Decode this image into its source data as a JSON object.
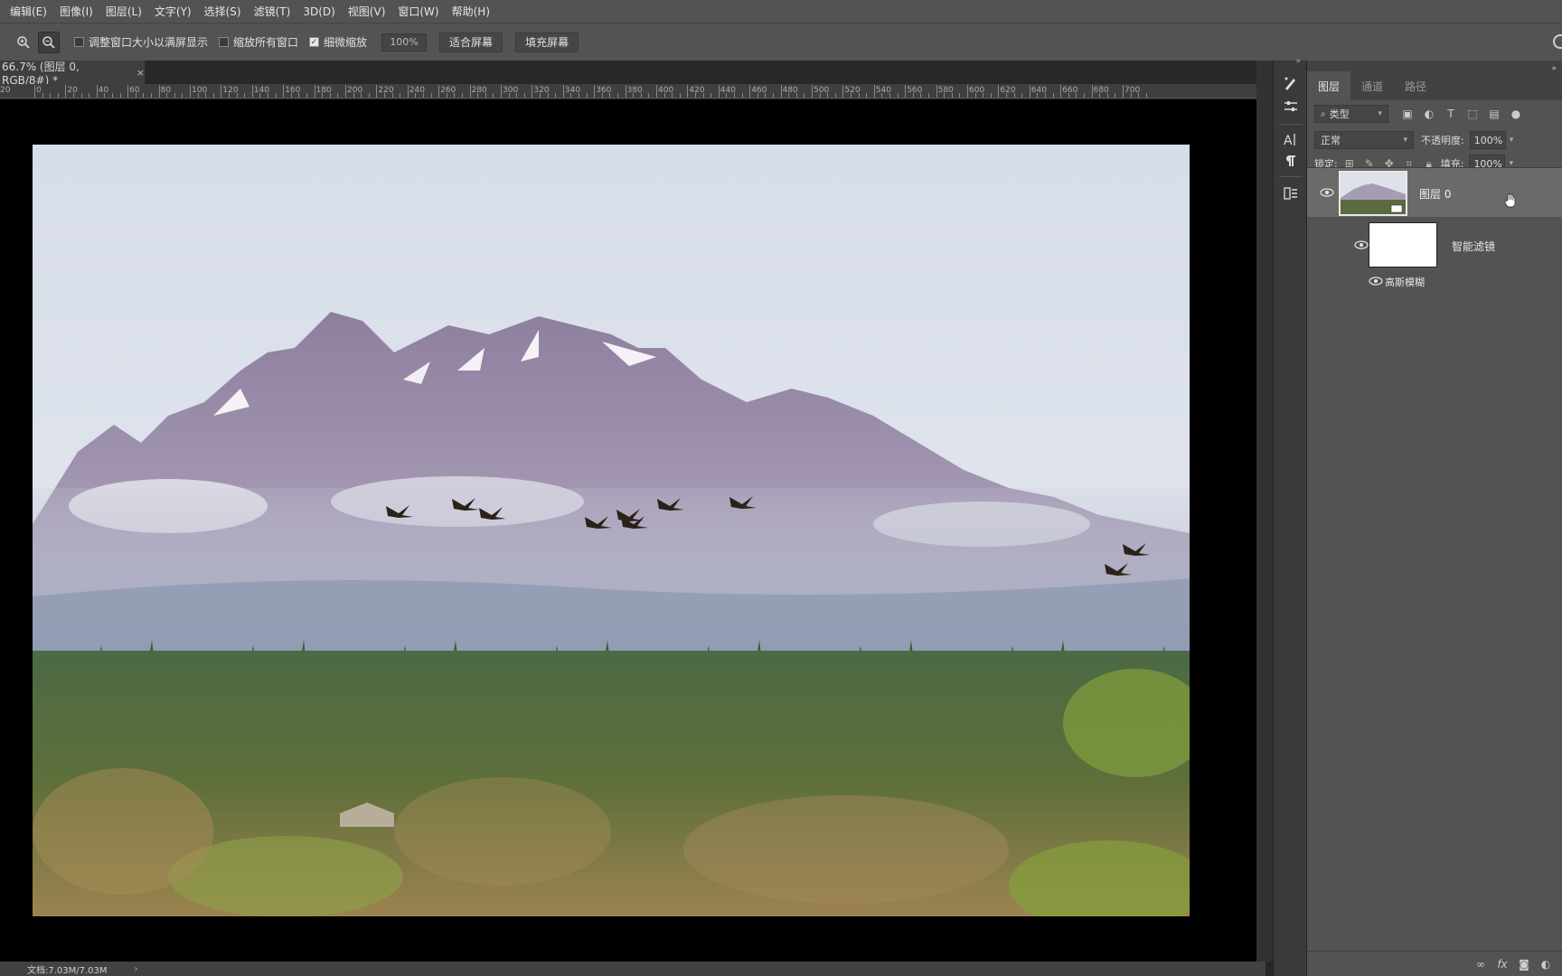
{
  "menu": [
    "编辑(E)",
    "图像(I)",
    "图层(L)",
    "文字(Y)",
    "选择(S)",
    "滤镜(T)",
    "3D(D)",
    "视图(V)",
    "窗口(W)",
    "帮助(H)"
  ],
  "options": {
    "zoom_in_icon": "zoom-in-icon",
    "zoom_out_icon": "zoom-out-icon",
    "resize_windows": {
      "label": "调整窗口大小以满屏显示",
      "checked": false
    },
    "zoom_all": {
      "label": "缩放所有窗口",
      "checked": false
    },
    "scrubby_zoom": {
      "label": "细微缩放",
      "checked": true
    },
    "zoom_value": "100%",
    "fit_screen": "适合屏幕",
    "fill_screen": "填充屏幕"
  },
  "document": {
    "tab_title": "66.7% (图层 0, RGB/8#) *",
    "close": "×"
  },
  "ruler": {
    "labels": [
      "0",
      "20",
      "40",
      "60",
      "80",
      "100",
      "120",
      "140",
      "160",
      "180",
      "200",
      "220",
      "240",
      "260",
      "280",
      "300",
      "320",
      "340",
      "360",
      "380",
      "400",
      "420",
      "440",
      "460",
      "480",
      "500",
      "520",
      "540",
      "560",
      "580",
      "600",
      "620",
      "640",
      "660",
      "680",
      "700"
    ],
    "first_label": "20"
  },
  "status": {
    "doc_size": "文档:7.03M/7.03M",
    "arrow": "›"
  },
  "panel": {
    "tabs": [
      "图层",
      "通道",
      "路径"
    ],
    "filter_kind": "类型",
    "blend_mode": "正常",
    "opacity_label": "不透明度:",
    "opacity_value": "100%",
    "lock_label": "锁定:",
    "fill_label": "填充:",
    "fill_value": "100%",
    "layers": {
      "layer0_name": "图层 0",
      "smart_filters_name": "智能滤镜",
      "filter_name": "高斯模糊"
    }
  },
  "colors": {
    "menu_bg": "#535353",
    "canvas_bg": "#000000",
    "panel_bg": "#535353",
    "selected_layer": "#6a6a6a"
  }
}
